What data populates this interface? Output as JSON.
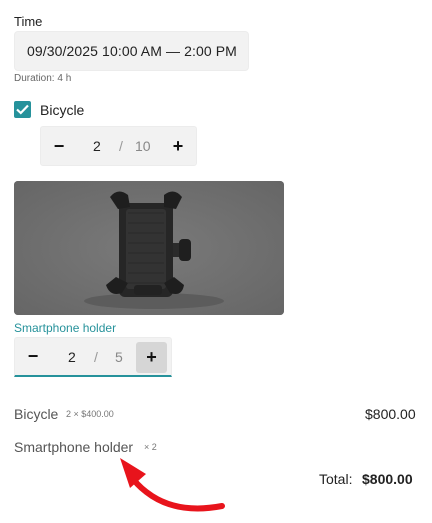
{
  "time": {
    "label": "Time",
    "value": "09/30/2025 10:00 AM — 2:00 PM",
    "duration": "Duration: 4 h"
  },
  "bicycle": {
    "checkbox_label": "Bicycle",
    "checked": true,
    "quantity": "2",
    "separator": "/",
    "max": "10"
  },
  "holder": {
    "label": "Smartphone holder",
    "quantity": "2",
    "separator": "/",
    "max": "5"
  },
  "stepper_icons": {
    "minus": "−",
    "plus": "+"
  },
  "summary": {
    "lines": [
      {
        "name": "Bicycle",
        "detail": "2 × $400.00",
        "price": "$800.00"
      },
      {
        "name": "Smartphone holder",
        "detail": "× 2",
        "price": ""
      }
    ],
    "total_label": "Total:",
    "total_value": "$800.00"
  },
  "colors": {
    "accent": "#26929b",
    "annotation_arrow": "#e8141c"
  }
}
